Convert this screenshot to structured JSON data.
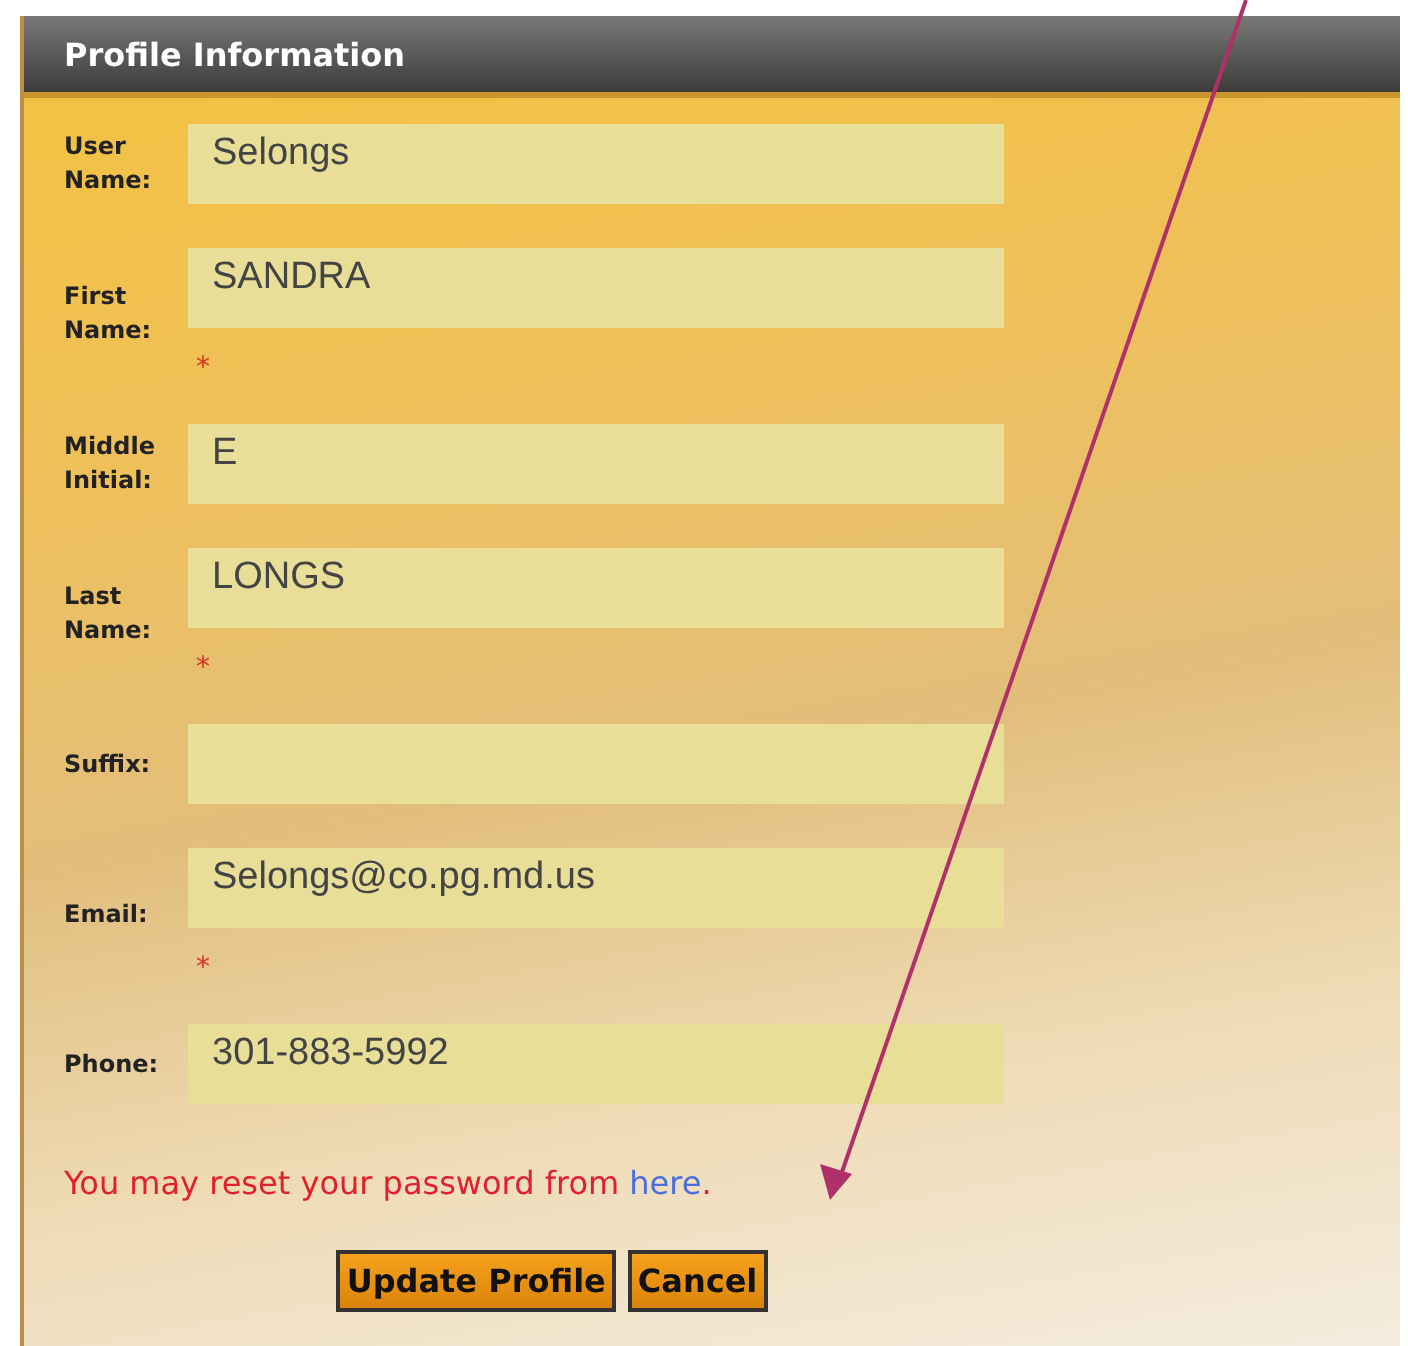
{
  "panel": {
    "title": "Profile Information"
  },
  "fields": [
    {
      "label": "User Name:",
      "value": "Selongs",
      "required": false
    },
    {
      "label": "First Name:",
      "value": "SANDRA",
      "required": true
    },
    {
      "label": "Middle Initial:",
      "value": "E",
      "required": false
    },
    {
      "label": "Last Name:",
      "value": "LONGS",
      "required": true
    },
    {
      "label": "Suffix:",
      "required": false
    },
    {
      "label": "Email:",
      "value": "Selongs@co.pg.md.us",
      "required": true
    },
    {
      "label": "Phone:",
      "value": "301-883-5992",
      "required": false
    }
  ],
  "required_mark": "*",
  "message": {
    "text": "You may reset your password from",
    "link": "here",
    "end": "."
  },
  "buttons": [
    "Update Profile",
    "Cancel"
  ]
}
